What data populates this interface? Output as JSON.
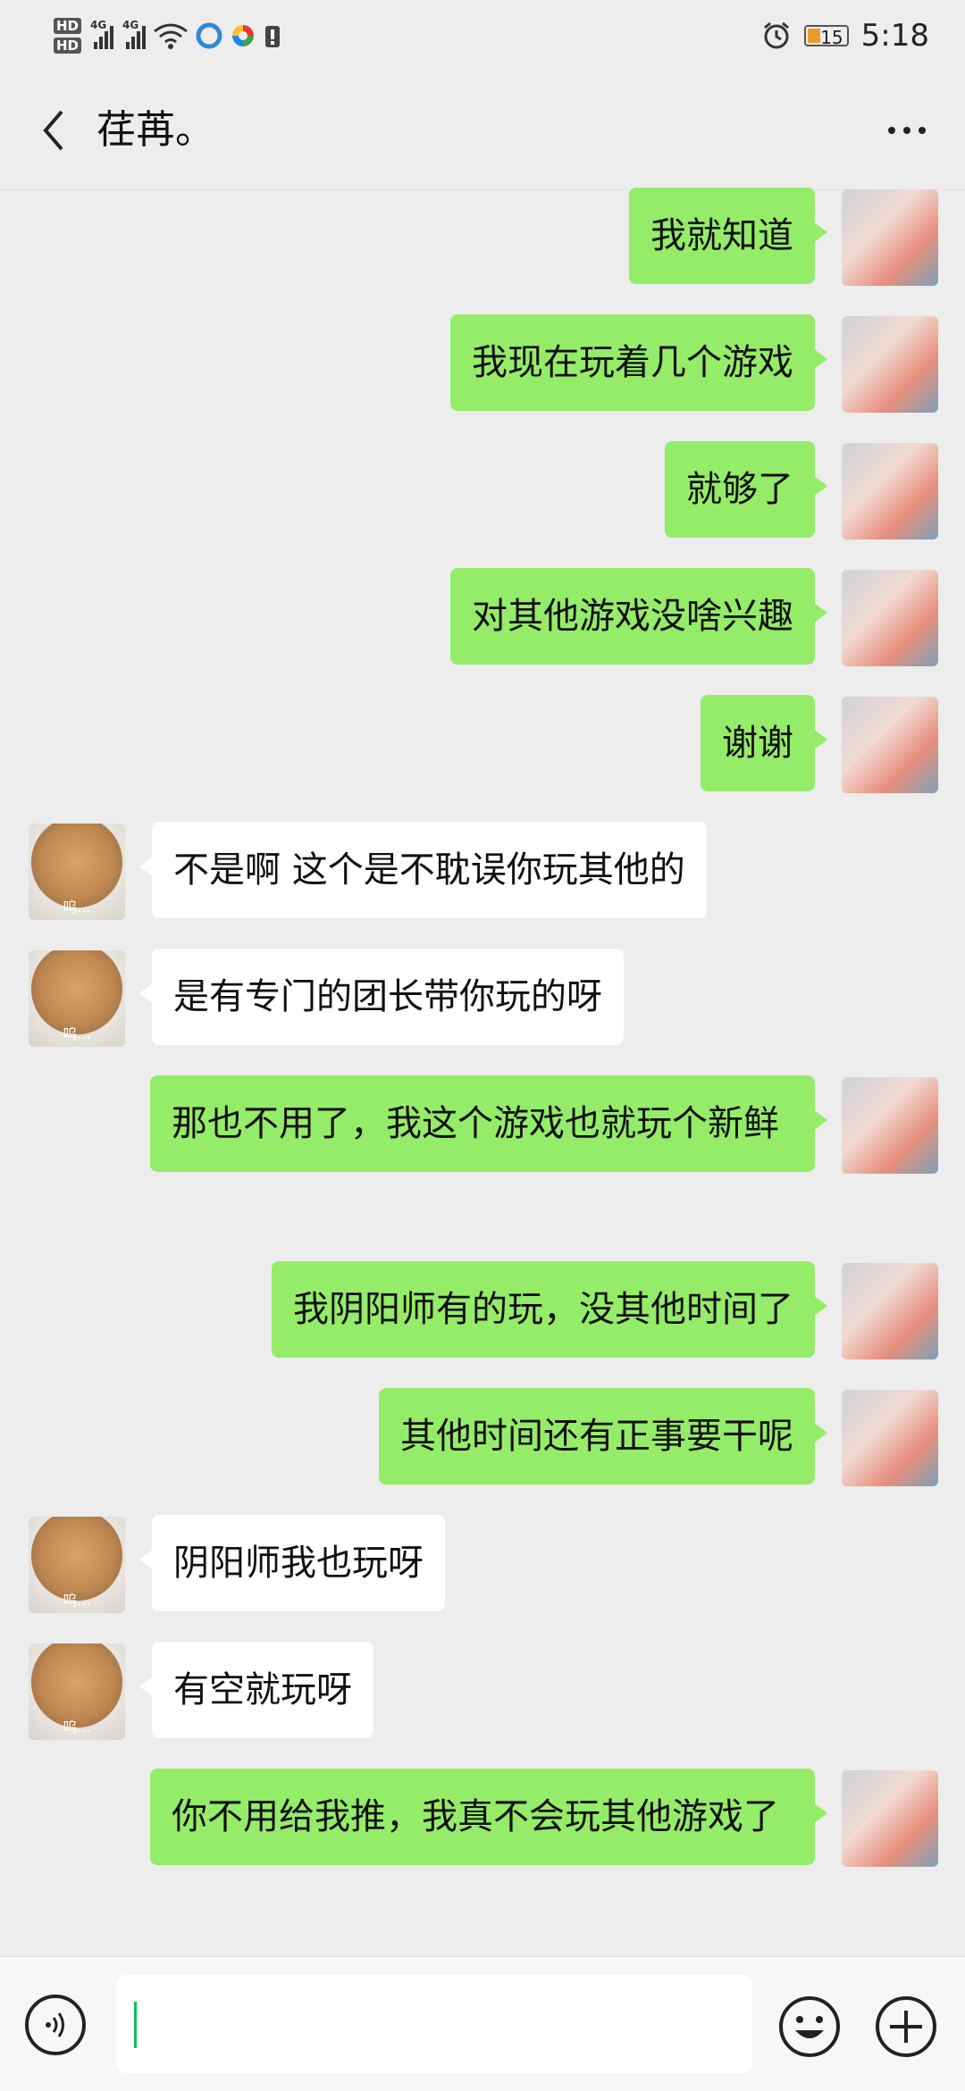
{
  "status_bar": {
    "hd1": "HD",
    "hd2": "HD",
    "net1": "4G",
    "net2": "4G",
    "battery": "15",
    "time": "5:18",
    "icons": [
      "alarm-icon",
      "wifi-icon",
      "battery-icon"
    ]
  },
  "header": {
    "title": "荏苒。",
    "back_icon": "chevron-left-icon",
    "more_icon": "more-dots-icon"
  },
  "messages": [
    {
      "from": "me",
      "text": "我就知道"
    },
    {
      "from": "me",
      "text": "我现在玩着几个游戏"
    },
    {
      "from": "me",
      "text": "就够了"
    },
    {
      "from": "me",
      "text": "对其他游戏没啥兴趣"
    },
    {
      "from": "me",
      "text": "谢谢"
    },
    {
      "from": "other",
      "text": "不是啊  这个是不耽误你玩其他的"
    },
    {
      "from": "other",
      "text": "是有专门的团长带你玩的呀"
    },
    {
      "from": "me",
      "text": "那也不用了，我这个游戏也就玩个新鲜"
    },
    {
      "from": "me",
      "text": "我阴阳师有的玩，没其他时间了"
    },
    {
      "from": "me",
      "text": "其他时间还有正事要干呢"
    },
    {
      "from": "other",
      "text": "阴阳师我也玩呀"
    },
    {
      "from": "other",
      "text": "有空就玩呀"
    },
    {
      "from": "me",
      "text": "你不用给我推，我真不会玩其他游戏了"
    }
  ],
  "avatar_caption_other": "呜...",
  "input_bar": {
    "value": "",
    "icons": [
      "voice-icon",
      "emoji-icon",
      "plus-icon"
    ]
  },
  "colors": {
    "background": "#ededed",
    "my_bubble": "#95ec69",
    "their_bubble": "#ffffff",
    "caret": "#07c160"
  }
}
